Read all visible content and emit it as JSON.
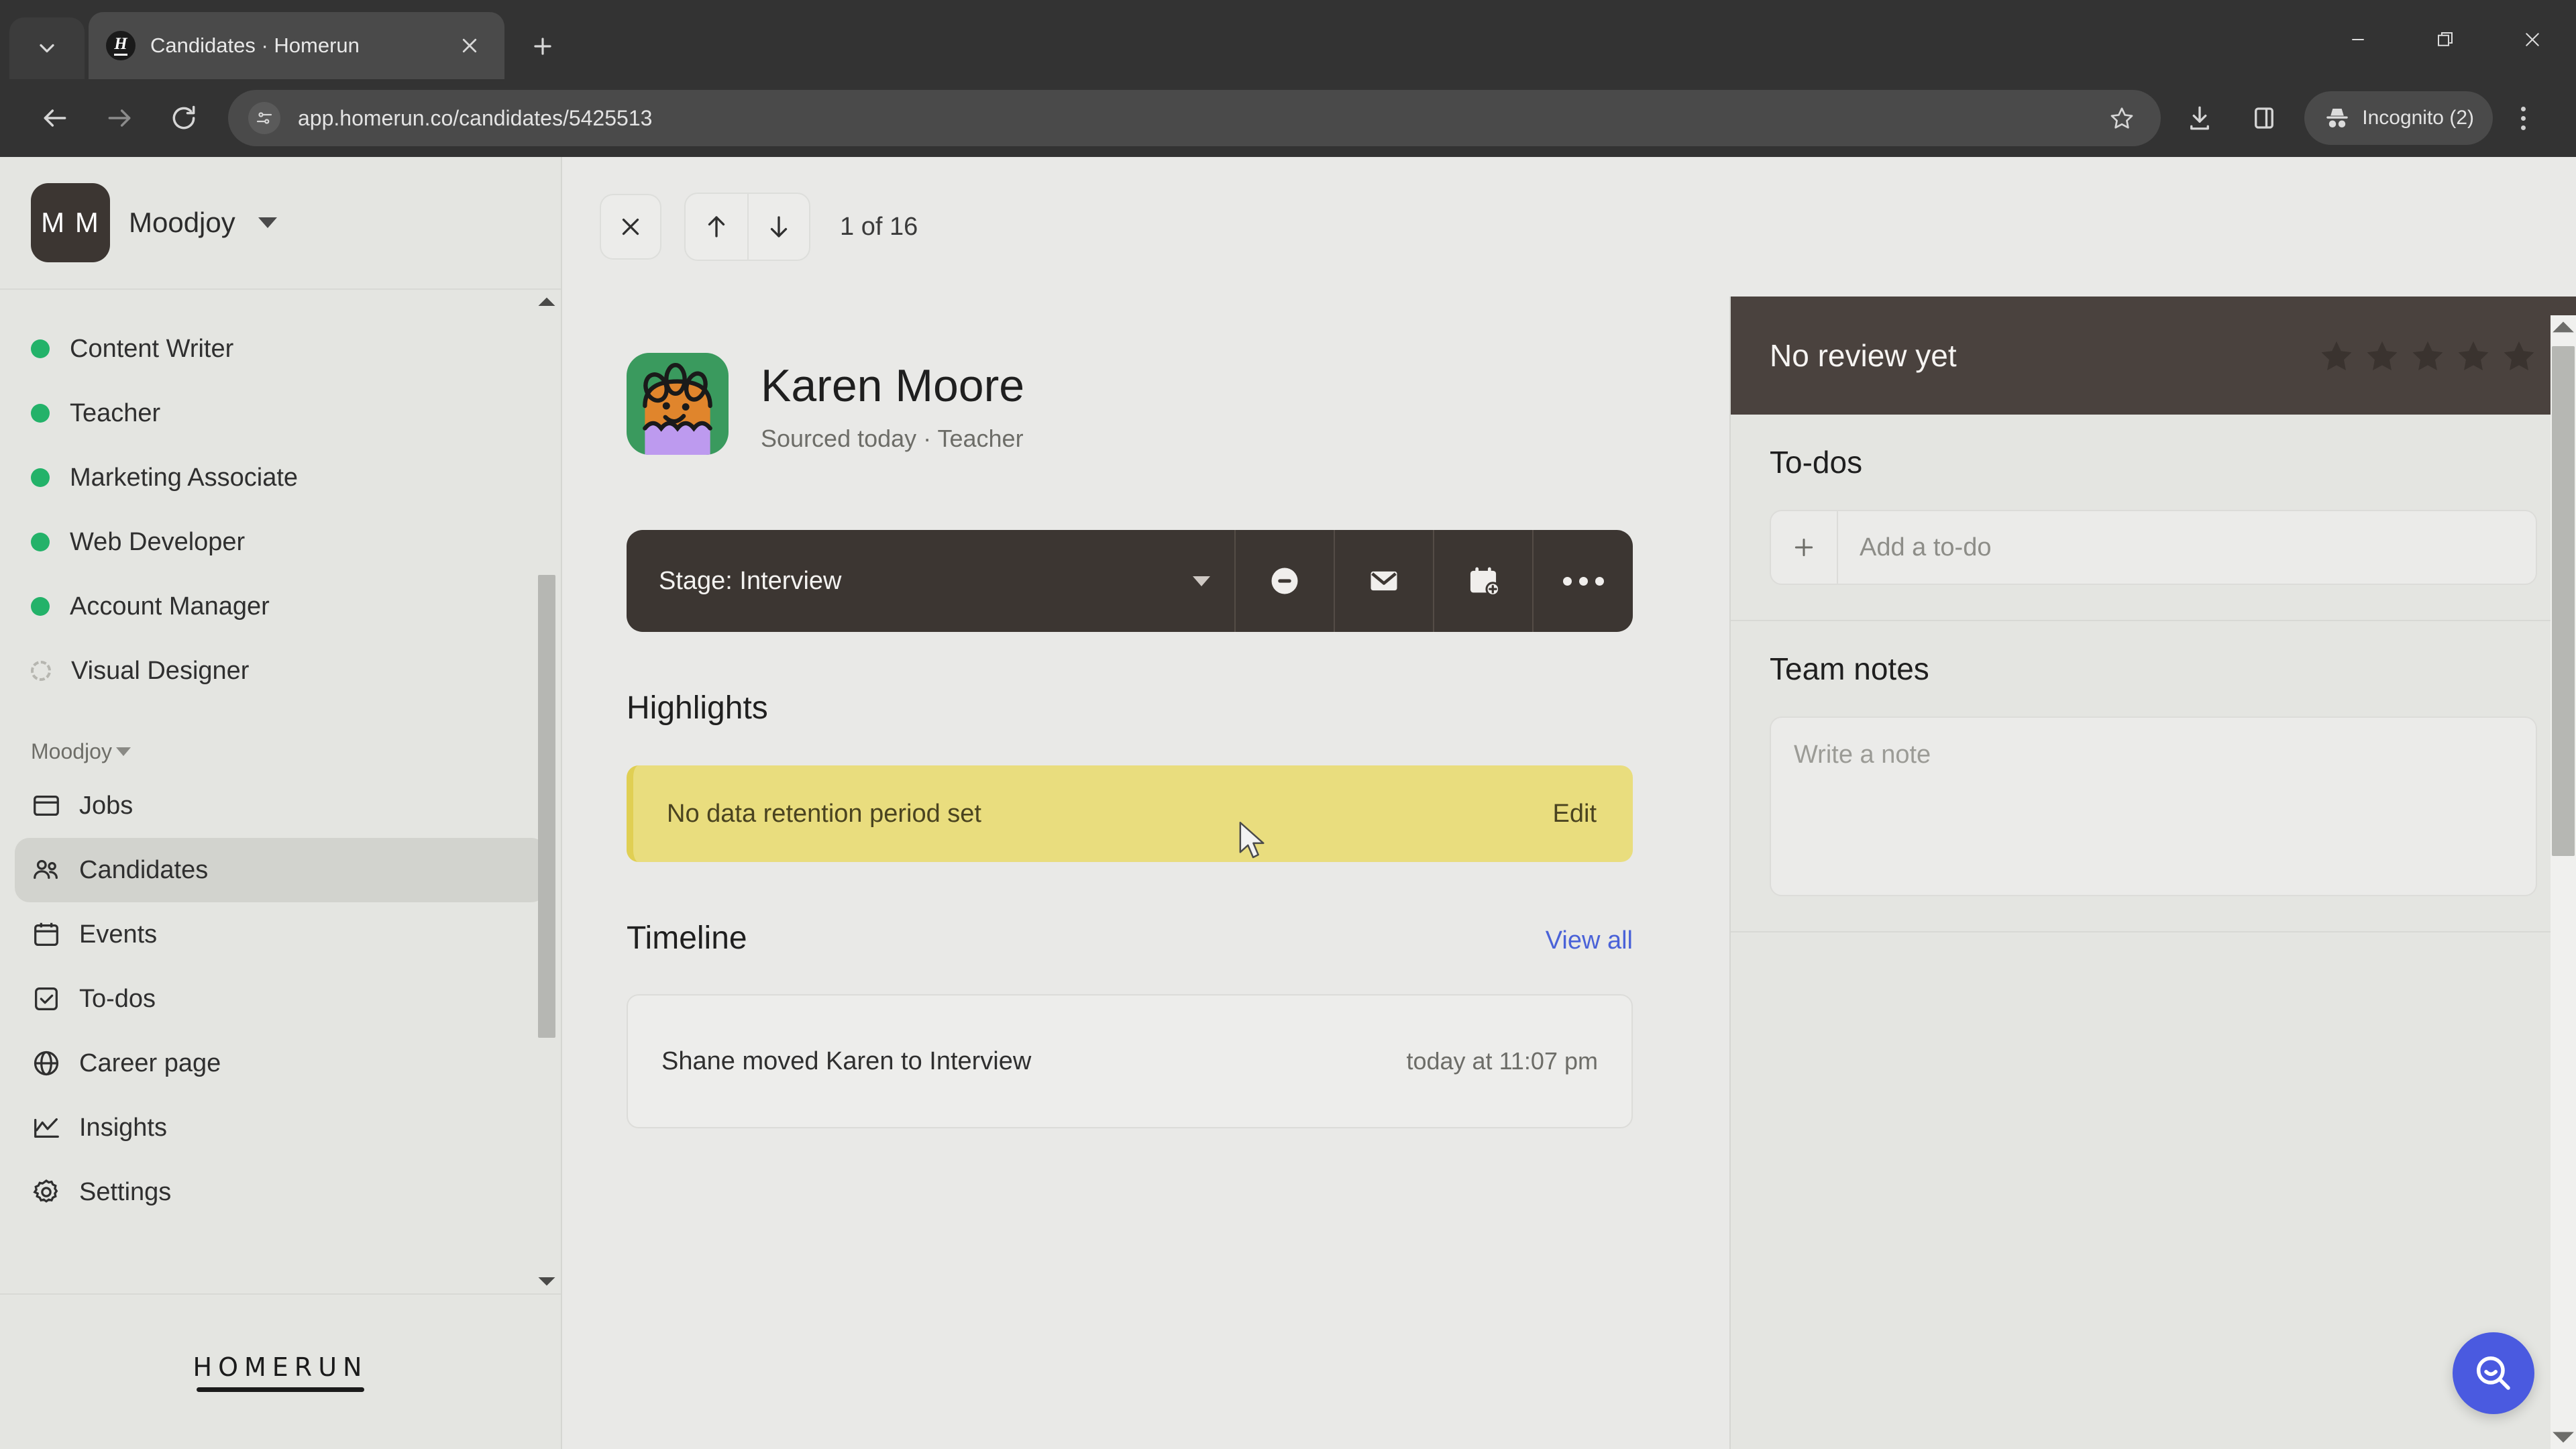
{
  "browser": {
    "tab": {
      "title": "Candidates · Homerun",
      "favicon_letter": "H"
    },
    "url": "app.homerun.co/candidates/5425513",
    "profile_label": "Incognito (2)",
    "icons": {
      "tab_list": "chevron-down-icon",
      "new_tab": "plus-icon",
      "back": "back-arrow-icon",
      "forward": "forward-arrow-icon",
      "reload": "reload-icon",
      "site_info": "site-settings-icon",
      "bookmark": "star-icon",
      "downloads": "download-icon",
      "side_panel": "side-panel-icon",
      "incognito": "incognito-hat-icon",
      "menu": "three-dot-menu-icon",
      "minimize": "minimize-icon",
      "maximize": "restore-icon",
      "close": "close-icon"
    }
  },
  "sidebar": {
    "org_name": "Moodjoy",
    "org_initials": "M M",
    "jobs": [
      {
        "label": "Content Writer",
        "status": "published"
      },
      {
        "label": "Teacher",
        "status": "published"
      },
      {
        "label": "Marketing Associate",
        "status": "published"
      },
      {
        "label": "Web Developer",
        "status": "published"
      },
      {
        "label": "Account Manager",
        "status": "published"
      },
      {
        "label": "Visual Designer",
        "status": "draft"
      }
    ],
    "workspace_label": "Moodjoy",
    "nav": [
      {
        "label": "Jobs",
        "icon": "jobs-board-icon",
        "active": false
      },
      {
        "label": "Candidates",
        "icon": "people-icon",
        "active": true
      },
      {
        "label": "Events",
        "icon": "calendar-icon",
        "active": false
      },
      {
        "label": "To-dos",
        "icon": "checkbox-icon",
        "active": false
      },
      {
        "label": "Career page",
        "icon": "globe-icon",
        "active": false
      },
      {
        "label": "Insights",
        "icon": "line-chart-icon",
        "active": false
      },
      {
        "label": "Settings",
        "icon": "gear-icon",
        "active": false
      }
    ],
    "brand": "HOMERUN"
  },
  "detail_toolbar": {
    "close_icon": "close-icon",
    "prev_icon": "arrow-up-icon",
    "next_icon": "arrow-down-icon",
    "counter": "1 of 16"
  },
  "candidate": {
    "name": "Karen Moore",
    "subtitle": "Sourced today · Teacher",
    "avatar": {
      "hair_color": "#3a9a5e",
      "face_color": "#e0852c",
      "shirt_color": "#bd9aef",
      "line_color": "#1a1a1a"
    }
  },
  "stage_bar": {
    "stage_label": "Stage: Interview",
    "actions": [
      {
        "name": "disqualify",
        "icon": "minus-circle-icon"
      },
      {
        "name": "email",
        "icon": "envelope-icon"
      },
      {
        "name": "schedule-event",
        "icon": "calendar-add-icon"
      },
      {
        "name": "more",
        "icon": "three-dots-icon"
      }
    ]
  },
  "highlights": {
    "title": "Highlights",
    "banner_text": "No data retention period set",
    "banner_action": "Edit",
    "banner_color": "#e9dd7e"
  },
  "timeline": {
    "title": "Timeline",
    "view_all": "View all",
    "events": [
      {
        "text": "Shane moved Karen to Interview",
        "time": "today at 11:07 pm"
      }
    ]
  },
  "right_panel": {
    "review": {
      "label": "No review yet",
      "stars": 5,
      "filled": 0
    },
    "todos": {
      "title": "To-dos",
      "placeholder": "Add a to-do",
      "add_icon": "plus-icon"
    },
    "notes": {
      "title": "Team notes",
      "placeholder": "Write a note"
    }
  },
  "fab": {
    "icon": "search-smile-icon",
    "color": "#4a5ae0"
  }
}
